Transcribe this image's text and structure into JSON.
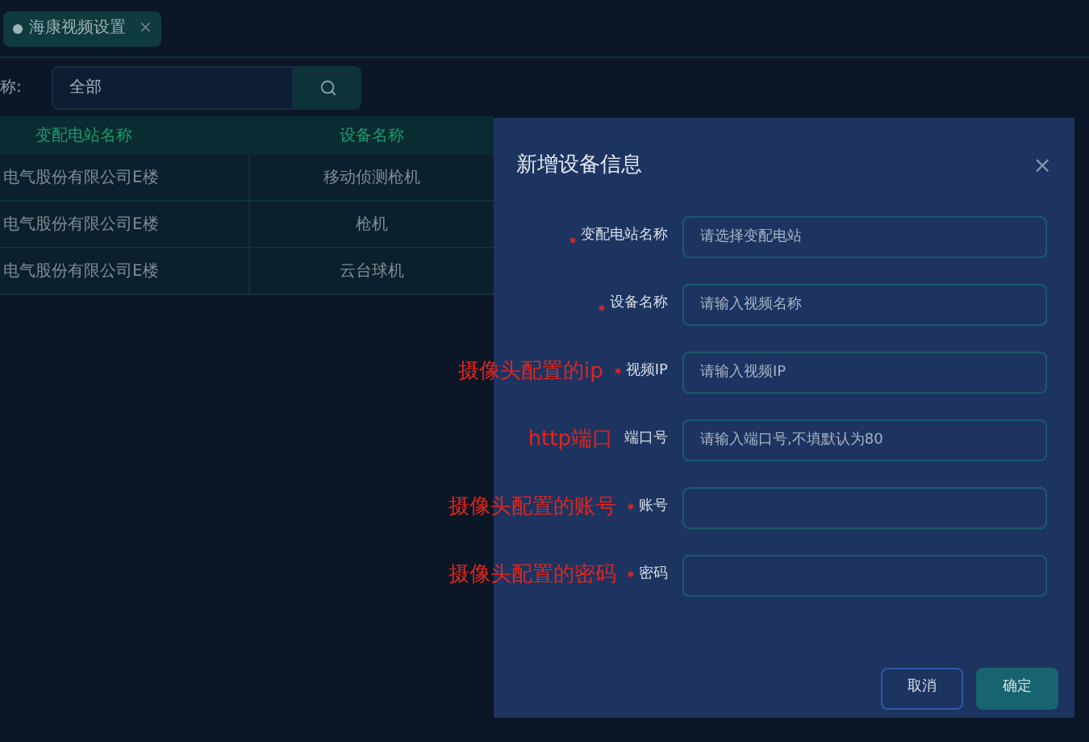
{
  "tabs": [
    {
      "label": "海康视频设置",
      "close": "×",
      "selected": true
    }
  ],
  "search": {
    "label": "称:",
    "value": "全部"
  },
  "table": {
    "columns": [
      "变配电站名称",
      "设备名称"
    ],
    "rows": [
      [
        "电气股份有限公司E楼",
        "移动侦测枪机"
      ],
      [
        "电气股份有限公司E楼",
        "枪机"
      ],
      [
        "电气股份有限公司E楼",
        "云台球机"
      ]
    ]
  },
  "dialog": {
    "title": "新增设备信息",
    "close": "×",
    "fields": [
      {
        "label": "变配电站名称",
        "required": true,
        "placeholder": "请选择变配电站"
      },
      {
        "label": "设备名称",
        "required": true,
        "placeholder": "请输入视频名称"
      },
      {
        "label": "视频IP",
        "required": true,
        "placeholder": "请输入视频IP",
        "annotation": "摄像头配置的ip"
      },
      {
        "label": "端口号",
        "required": false,
        "placeholder": "请输入端口号,不填默认为80",
        "annotation": "http端口"
      },
      {
        "label": "账号",
        "required": true,
        "annotation": "摄像头配置的账号"
      },
      {
        "label": "密码",
        "required": true,
        "annotation": "摄像头配置的密码"
      }
    ],
    "buttons": [
      {
        "label": "取消",
        "kind": "secondary"
      },
      {
        "label": "确定",
        "kind": "primary"
      }
    ]
  }
}
